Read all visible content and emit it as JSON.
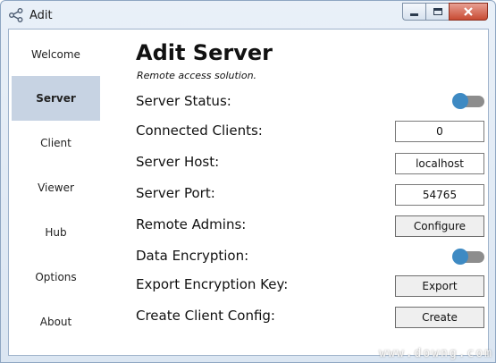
{
  "window": {
    "title": "Adit",
    "app_icon": "share-icon",
    "controls": [
      "minimize-icon",
      "maximize-icon",
      "close-icon"
    ]
  },
  "sidebar": {
    "items": [
      {
        "label": "Welcome",
        "active": false
      },
      {
        "label": "Server",
        "active": true
      },
      {
        "label": "Client",
        "active": false
      },
      {
        "label": "Viewer",
        "active": false
      },
      {
        "label": "Hub",
        "active": false
      },
      {
        "label": "Options",
        "active": false
      },
      {
        "label": "About",
        "active": false
      }
    ]
  },
  "main": {
    "title": "Adit Server",
    "subtitle": "Remote access solution.",
    "server_status": {
      "label": "Server Status:",
      "on": false
    },
    "connected_clients": {
      "label": "Connected Clients:",
      "value": "0"
    },
    "server_host": {
      "label": "Server Host:",
      "value": "localhost"
    },
    "server_port": {
      "label": "Server Port:",
      "value": "54765"
    },
    "remote_admins": {
      "label": "Remote Admins:",
      "button": "Configure"
    },
    "data_encryption": {
      "label": "Data Encryption:",
      "on": false
    },
    "export_key": {
      "label": "Export Encryption Key:",
      "button": "Export"
    },
    "client_config": {
      "label": "Create Client Config:",
      "button": "Create"
    }
  },
  "colors": {
    "accent": "#3e8ac3",
    "active_nav": "#c7d3e3",
    "toggle_track": "#8d8d8d"
  },
  "watermark": "www.downg.com"
}
